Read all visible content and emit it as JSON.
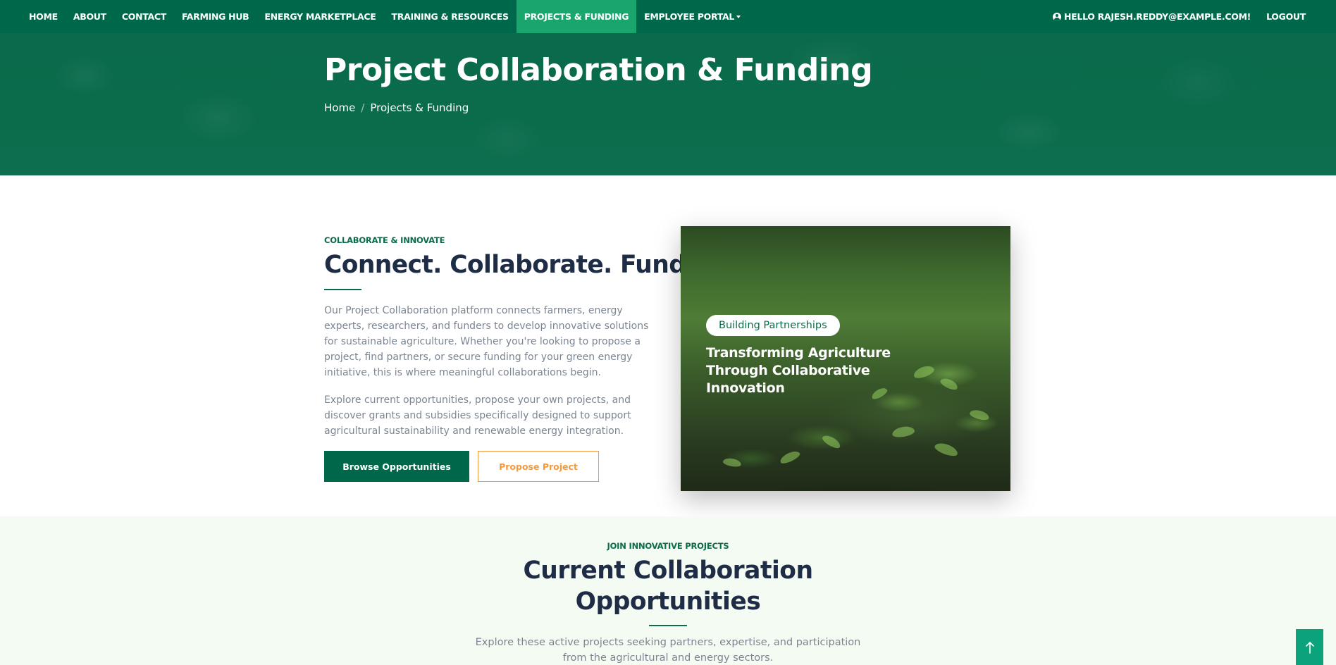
{
  "nav": {
    "items": [
      {
        "label": "HOME"
      },
      {
        "label": "ABOUT"
      },
      {
        "label": "CONTACT"
      },
      {
        "label": "FARMING HUB"
      },
      {
        "label": "ENERGY MARKETPLACE"
      },
      {
        "label": "TRAINING & RESOURCES"
      },
      {
        "label": "PROJECTS & FUNDING",
        "active": true
      },
      {
        "label": "EMPLOYEE PORTAL",
        "dropdown": true
      }
    ],
    "user_greeting": "HELLO RAJESH.REDDY@EXAMPLE.COM!",
    "logout": "LOGOUT",
    "accent_color": "#00684a",
    "active_color": "#1aa56c"
  },
  "hero": {
    "title": "Project Collaboration & Funding",
    "breadcrumb": {
      "home": "Home",
      "current": "Projects & Funding"
    }
  },
  "intro": {
    "eyebrow": "COLLABORATE & INNOVATE",
    "heading": "Connect. Collaborate. Fund.",
    "paragraph1": "Our Project Collaboration platform connects farmers, energy experts, researchers, and funders to develop innovative solutions for sustainable agriculture. Whether you're looking to propose a project, find partners, or secure funding for your green energy initiative, this is where meaningful collaborations begin.",
    "paragraph2": "Explore current opportunities, propose your own projects, and discover grants and subsidies specifically designed to support agricultural sustainability and renewable energy integration.",
    "browse_button": "Browse Opportunities",
    "propose_button": "Propose Project",
    "outline_color": "#f29a3d"
  },
  "image_card": {
    "badge": "Building Partnerships",
    "title": "Transforming Agriculture Through Collaborative Innovation"
  },
  "opportunities": {
    "eyebrow": "JOIN INNOVATIVE PROJECTS",
    "heading_line1": "Current Collaboration",
    "heading_line2": "Opportunities",
    "description_line1": "Explore these active projects seeking partners, expertise, and participation",
    "description_line2": "from the agricultural and energy sectors."
  },
  "back_to_top_icon": "arrow-up-icon"
}
